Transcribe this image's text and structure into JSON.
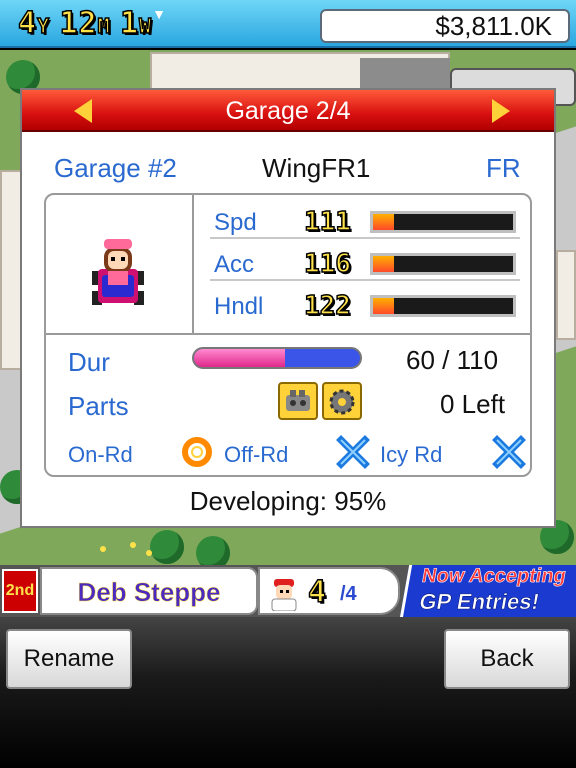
{
  "status_bar": {
    "year": "4",
    "year_unit": "Y",
    "month": "12",
    "month_unit": "M",
    "week": "1",
    "week_unit": "W",
    "money": "$3,811.0K"
  },
  "dialog": {
    "title": "Garage 2/4",
    "garage_label": "Garage #2",
    "car_name": "WingFR1",
    "drive_type": "FR",
    "stats": [
      {
        "label": "Spd",
        "value": "111",
        "level": 0.15
      },
      {
        "label": "Acc",
        "value": "116",
        "level": 0.15
      },
      {
        "label": "Hndl",
        "value": "122",
        "level": 0.15
      }
    ],
    "durability": {
      "label": "Dur",
      "current": 60,
      "max": 110,
      "text": "60 / 110"
    },
    "parts": {
      "label": "Parts",
      "left_text": "0 Left",
      "icons": [
        "engine-part-icon",
        "gear-part-icon"
      ]
    },
    "conditions": [
      {
        "label": "On-Rd",
        "icon": "circle-good-icon"
      },
      {
        "label": "Off-Rd",
        "icon": "cross-bad-icon"
      },
      {
        "label": "Icy Rd",
        "icon": "cross-bad-icon"
      }
    ],
    "developing": "Developing: 95%"
  },
  "info_strip": {
    "rank": "2nd",
    "driver_name": "Deb Steppe",
    "crew_count": "4",
    "crew_total": "/4",
    "ad_line1": "Now Accepting",
    "ad_line2": "GP Entries!"
  },
  "buttons": {
    "rename": "Rename",
    "back": "Back"
  },
  "colors": {
    "header_red": "#d81010",
    "label_blue": "#2a6ad0",
    "accent_yellow": "#ffd23a",
    "condition_orange": "#ff8a00",
    "condition_cross_blue": "#1a7ae0"
  }
}
